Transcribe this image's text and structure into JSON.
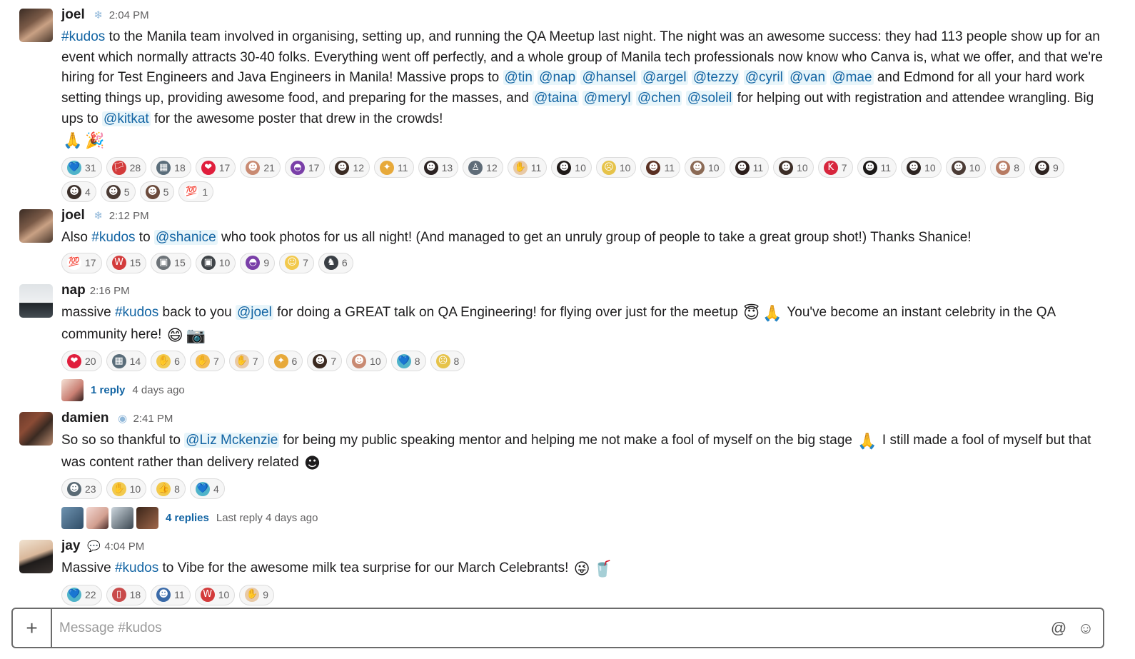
{
  "messages": [
    {
      "author": "joel",
      "status_icon": "snowflake-icon",
      "time": "2:04 PM",
      "text": [
        {
          "t": "channel",
          "v": "#kudos"
        },
        {
          "t": "text",
          "v": " to the Manila team involved in organising, setting up, and running the QA Meetup last night. The night was an awesome success: they had 113 people show up for an event which normally attracts 30-40 folks. Everything went off perfectly, and a whole group of Manila tech professionals now know who Canva is, what we offer, and that we're hiring for Test Engineers and Java Engineers in Manila! Massive props to "
        },
        {
          "t": "mention",
          "v": "@tin"
        },
        {
          "t": "text",
          "v": " "
        },
        {
          "t": "mention",
          "v": "@nap"
        },
        {
          "t": "text",
          "v": " "
        },
        {
          "t": "mention",
          "v": "@hansel"
        },
        {
          "t": "text",
          "v": " "
        },
        {
          "t": "mention",
          "v": "@argel"
        },
        {
          "t": "text",
          "v": " "
        },
        {
          "t": "mention",
          "v": "@tezzy"
        },
        {
          "t": "text",
          "v": " "
        },
        {
          "t": "mention",
          "v": "@cyril"
        },
        {
          "t": "text",
          "v": " "
        },
        {
          "t": "mention",
          "v": "@van"
        },
        {
          "t": "text",
          "v": " "
        },
        {
          "t": "mention",
          "v": "@mae"
        },
        {
          "t": "text",
          "v": " and Edmond for all your hard work setting things up, providing awesome food, and preparing for the masses, and "
        },
        {
          "t": "mention",
          "v": "@taina"
        },
        {
          "t": "text",
          "v": " "
        },
        {
          "t": "mention",
          "v": "@meryl"
        },
        {
          "t": "text",
          "v": " "
        },
        {
          "t": "mention",
          "v": "@chen"
        },
        {
          "t": "text",
          "v": " "
        },
        {
          "t": "mention",
          "v": "@soleil"
        },
        {
          "t": "text",
          "v": " for helping out with registration and attendee wrangling. Big ups to "
        },
        {
          "t": "mention",
          "v": "@kitkat"
        },
        {
          "t": "text",
          "v": " for the awesome poster that drew in the crowds!"
        },
        {
          "t": "br"
        },
        {
          "t": "emoji",
          "v": "🙏"
        },
        {
          "t": "emoji",
          "v": "🎉"
        }
      ],
      "reactions": [
        {
          "icon": "💙",
          "color": "#4fb3c9",
          "count": "31"
        },
        {
          "icon": "🏳",
          "color": "#d33b3b",
          "count": "28"
        },
        {
          "icon": "▦",
          "color": "#5a6d7a",
          "count": "18"
        },
        {
          "icon": "❤",
          "color": "#e01e3c",
          "count": "17"
        },
        {
          "icon": "☻",
          "color": "#c98a72",
          "count": "21"
        },
        {
          "icon": "◓",
          "color": "#7a3fa8",
          "count": "17"
        },
        {
          "icon": "☻",
          "color": "#3a2a22",
          "count": "12"
        },
        {
          "icon": "✦",
          "color": "#e7a93a",
          "count": "11"
        },
        {
          "icon": "☻",
          "color": "#2b2322",
          "count": "13"
        },
        {
          "icon": "♙",
          "color": "#5f6c78",
          "count": "12"
        },
        {
          "icon": "✋",
          "color": "#e8c9a6",
          "count": "11"
        },
        {
          "icon": "☻",
          "color": "#1f1a18",
          "count": "10"
        },
        {
          "icon": "☹",
          "color": "#e6c34a",
          "count": "10"
        },
        {
          "icon": "☻",
          "color": "#5a3022",
          "count": "11"
        },
        {
          "icon": "☻",
          "color": "#8b6a55",
          "count": "10"
        },
        {
          "icon": "☻",
          "color": "#2a1d1a",
          "count": "11"
        },
        {
          "icon": "☻",
          "color": "#3c2e27",
          "count": "10"
        },
        {
          "icon": "K",
          "color": "#d7263d",
          "count": "7"
        },
        {
          "icon": "☻",
          "color": "#1b1817",
          "count": "11"
        },
        {
          "icon": "☻",
          "color": "#2d2522",
          "count": "10"
        },
        {
          "icon": "☻",
          "color": "#4b3b35",
          "count": "10"
        },
        {
          "icon": "☻",
          "color": "#b77b63",
          "count": "8"
        },
        {
          "icon": "☻",
          "color": "#2e2320",
          "count": "9"
        },
        {
          "icon": "☻",
          "color": "#3b2f2a",
          "count": "4"
        },
        {
          "icon": "☻",
          "color": "#4a3a33",
          "count": "5"
        },
        {
          "icon": "☻",
          "color": "#6b4a3b",
          "count": "5"
        },
        {
          "icon": "💯",
          "color": "#ffffff",
          "count": "1"
        }
      ]
    },
    {
      "author": "joel",
      "status_icon": "snowflake-icon",
      "time": "2:12 PM",
      "text": [
        {
          "t": "text",
          "v": "Also "
        },
        {
          "t": "channel",
          "v": "#kudos"
        },
        {
          "t": "text",
          "v": " to "
        },
        {
          "t": "mention",
          "v": "@shanice"
        },
        {
          "t": "text",
          "v": " who took photos for us all night! (And managed to get an unruly group of people to take a great group shot!) Thanks Shanice!"
        }
      ],
      "reactions": [
        {
          "icon": "💯",
          "color": "#ffffff",
          "count": "17"
        },
        {
          "icon": "W",
          "color": "#d33b3b",
          "count": "15"
        },
        {
          "icon": "▣",
          "color": "#6d7378",
          "count": "15"
        },
        {
          "icon": "▣",
          "color": "#3f4448",
          "count": "10"
        },
        {
          "icon": "◓",
          "color": "#7a3fa8",
          "count": "9"
        },
        {
          "icon": "☺",
          "color": "#f2c94c",
          "count": "7"
        },
        {
          "icon": "♞",
          "color": "#3a3f45",
          "count": "6"
        }
      ]
    },
    {
      "author": "nap",
      "status_icon": "",
      "time": "2:16 PM",
      "text": [
        {
          "t": "text",
          "v": "massive "
        },
        {
          "t": "channel",
          "v": "#kudos"
        },
        {
          "t": "text",
          "v": " back to you "
        },
        {
          "t": "mention",
          "v": "@joel"
        },
        {
          "t": "text",
          "v": " for doing a GREAT talk on QA Engineering! for flying over just for the meetup "
        },
        {
          "t": "emoji",
          "v": "😇"
        },
        {
          "t": "emoji",
          "v": "🙏"
        },
        {
          "t": "text",
          "v": " You've become an instant celebrity in the QA community here! "
        },
        {
          "t": "emoji",
          "v": "😄"
        },
        {
          "t": "emoji",
          "v": "📷"
        }
      ],
      "reactions": [
        {
          "icon": "❤",
          "color": "#e01e3c",
          "count": "20"
        },
        {
          "icon": "▦",
          "color": "#5a6d7a",
          "count": "14"
        },
        {
          "icon": "✋",
          "color": "#f2c94c",
          "count": "6"
        },
        {
          "icon": "✋",
          "color": "#f2b94c",
          "count": "7"
        },
        {
          "icon": "✋",
          "color": "#e8c9a6",
          "count": "7"
        },
        {
          "icon": "✦",
          "color": "#e7a93a",
          "count": "6"
        },
        {
          "icon": "☻",
          "color": "#3b2a20",
          "count": "7"
        },
        {
          "icon": "☻",
          "color": "#c98a72",
          "count": "10"
        },
        {
          "icon": "💙",
          "color": "#4fb3c9",
          "count": "8"
        },
        {
          "icon": "☹",
          "color": "#e6c34a",
          "count": "8"
        }
      ],
      "thread": {
        "avatars": [
          "m1"
        ],
        "label": "1 reply",
        "meta": "4 days ago"
      }
    },
    {
      "author": "damien",
      "status_icon": "globe-icon",
      "time": "2:41 PM",
      "text": [
        {
          "t": "text",
          "v": "So so so thankful to "
        },
        {
          "t": "mention",
          "v": "@Liz Mckenzie"
        },
        {
          "t": "text",
          "v": " for being my public speaking mentor and helping me not make a fool of myself on the big stage "
        },
        {
          "t": "emoji",
          "v": "🙏"
        },
        {
          "t": "text",
          "v": " I still made a fool of myself but that was content rather than delivery related "
        },
        {
          "t": "emoji",
          "v": "☻"
        }
      ],
      "reactions": [
        {
          "icon": "☻",
          "color": "#5a6a74",
          "count": "23"
        },
        {
          "icon": "✋",
          "color": "#f2c94c",
          "count": "10"
        },
        {
          "icon": "👍",
          "color": "#f2c94c",
          "count": "8"
        },
        {
          "icon": "💙",
          "color": "#4fb3c9",
          "count": "4"
        }
      ],
      "thread": {
        "avatars": [
          "m2",
          "m3",
          "m4",
          "m5"
        ],
        "label": "4 replies",
        "meta": "Last reply 4 days ago"
      }
    },
    {
      "author": "jay",
      "status_icon": "speech-icon",
      "time": "4:04 PM",
      "text": [
        {
          "t": "text",
          "v": "Massive "
        },
        {
          "t": "channel",
          "v": "#kudos"
        },
        {
          "t": "text",
          "v": " to Vibe for the awesome milk tea surprise for our March Celebrants! "
        },
        {
          "t": "emoji",
          "v": "😜"
        },
        {
          "t": "emoji",
          "v": "🥤"
        }
      ],
      "reactions": [
        {
          "icon": "💙",
          "color": "#4fb3c9",
          "count": "22"
        },
        {
          "icon": "▯",
          "color": "#c94b4b",
          "count": "18"
        },
        {
          "icon": "☻",
          "color": "#3a6aa8",
          "count": "11"
        },
        {
          "icon": "W",
          "color": "#d33b3b",
          "count": "10"
        },
        {
          "icon": "✋",
          "color": "#e8c9a6",
          "count": "9"
        }
      ]
    }
  ],
  "composer": {
    "placeholder": "Message #kudos",
    "plus_icon": "plus-icon",
    "at_icon": "at-icon",
    "emoji_icon": "emoji-icon"
  }
}
